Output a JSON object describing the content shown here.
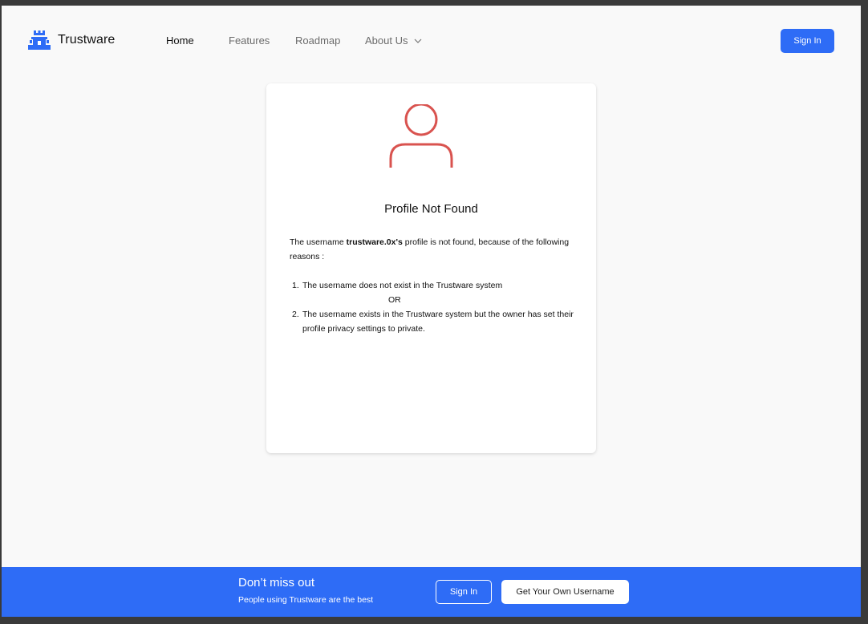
{
  "brand": {
    "name": "Trustware",
    "logo_icon": "castle-icon",
    "accent": "#2e6cf6"
  },
  "nav": {
    "home": "Home",
    "features": "Features",
    "roadmap": "Roadmap",
    "about": "About Us"
  },
  "header": {
    "sign_in": "Sign In"
  },
  "card": {
    "icon": "user-icon",
    "icon_color": "#d9534f",
    "title": "Profile Not Found",
    "intro_prefix": "The username ",
    "username": "trustware.0x's",
    "intro_suffix": " profile is not found, because of the following reasons :",
    "reasons": [
      {
        "num": "1.",
        "text": "The username does not exist in the Trustware system"
      },
      {
        "num": "2.",
        "text": "The username exists in the Trustware system but the owner has set their profile privacy settings to private."
      }
    ],
    "separator": "OR"
  },
  "footer": {
    "title": "Don’t miss out",
    "subtitle": "People using Trustware are the best",
    "sign_in": "Sign In",
    "get_username": "Get Your Own Username"
  }
}
